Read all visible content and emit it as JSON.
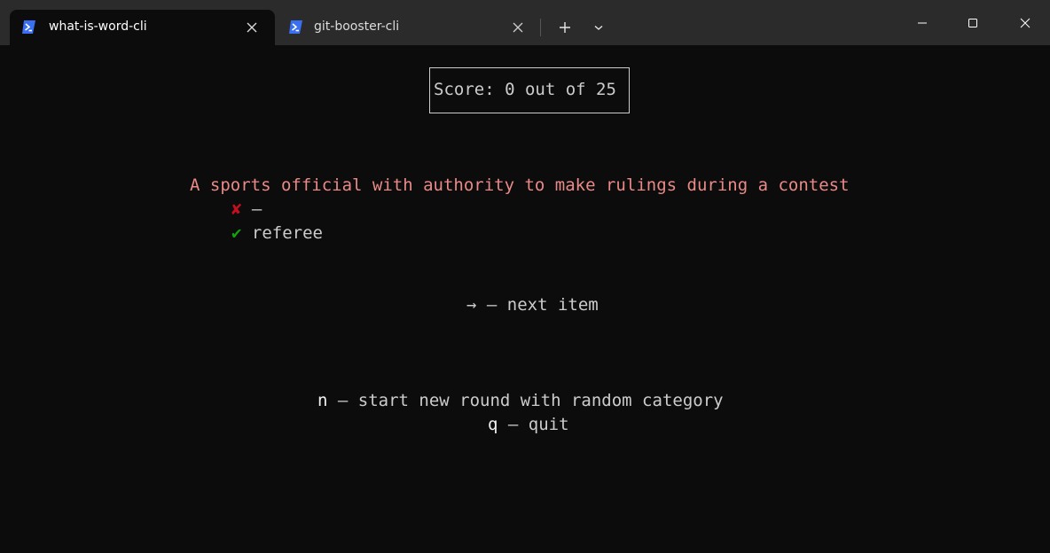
{
  "window": {
    "tabs": [
      {
        "title": "what-is-word-cli",
        "active": true,
        "icon": "powershell-icon"
      },
      {
        "title": "git-booster-cli",
        "active": false,
        "icon": "powershell-icon"
      }
    ],
    "new_tab_icon": "plus-icon",
    "dropdown_icon": "chevron-down-icon",
    "controls": [
      "minimize-icon",
      "maximize-icon",
      "close-icon"
    ]
  },
  "terminal": {
    "score": "Score: 0 out of 25",
    "definition": "A sports official with authority to make rulings during a contest",
    "wrong_answer": {
      "mark": "✘",
      "text": " –"
    },
    "correct_answer": {
      "mark": "✔",
      "text": " referee"
    },
    "next_hint": "→ – next item",
    "new_round_hint": {
      "key": "n",
      "text": " – start new round with random category"
    },
    "quit_hint": {
      "key": "q",
      "text": " – quit"
    }
  },
  "colors": {
    "background": "#0c0c0c",
    "titlebar": "#2b2b2b",
    "text": "#cccccc",
    "definition": "#e98a87",
    "wrong": "#c50f1f",
    "correct": "#13a10e",
    "powershell_icon": "#3a6ff2"
  }
}
